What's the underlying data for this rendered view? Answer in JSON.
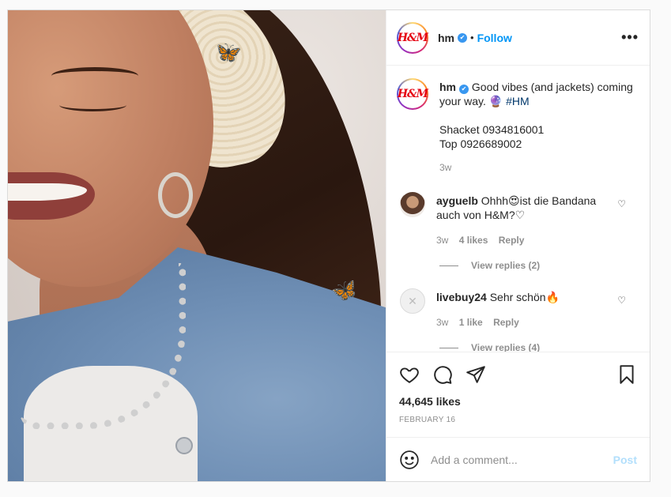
{
  "header": {
    "username": "hm",
    "dot": "•",
    "follow_label": "Follow",
    "more_label": "•••"
  },
  "avatar_logo": "H&M",
  "caption": {
    "username": "hm",
    "line1": "Good vibes (and jackets)",
    "line2": "coming your way.",
    "emoji": "🔮",
    "hashtag": "#HM",
    "line3": "Shacket 0934816001",
    "line4": "Top 0926689002",
    "time": "3w"
  },
  "comments": [
    {
      "username": "ayguelb",
      "text_before": "Ohhh",
      "emoji": "😍",
      "text_after": "ist die Bandana auch von H&M?",
      "trailing": "♡",
      "time": "3w",
      "likes": "4 likes",
      "reply": "Reply",
      "view_replies": "View replies (2)"
    },
    {
      "username": "livebuy24",
      "text_before": "Sehr schön",
      "emoji": "🔥",
      "text_after": "",
      "trailing": "",
      "time": "3w",
      "likes": "1 like",
      "reply": "Reply",
      "view_replies": "View replies (4)"
    }
  ],
  "likes_count": "44,645 likes",
  "post_date": "FEBRUARY 16",
  "add_comment": {
    "placeholder": "Add a comment...",
    "post_label": "Post"
  },
  "colors": {
    "follow": "#0095f6",
    "post_disabled": "#b2dffc",
    "hashtag": "#00376b",
    "verified": "#3897f0",
    "brand_red": "#e50010"
  }
}
